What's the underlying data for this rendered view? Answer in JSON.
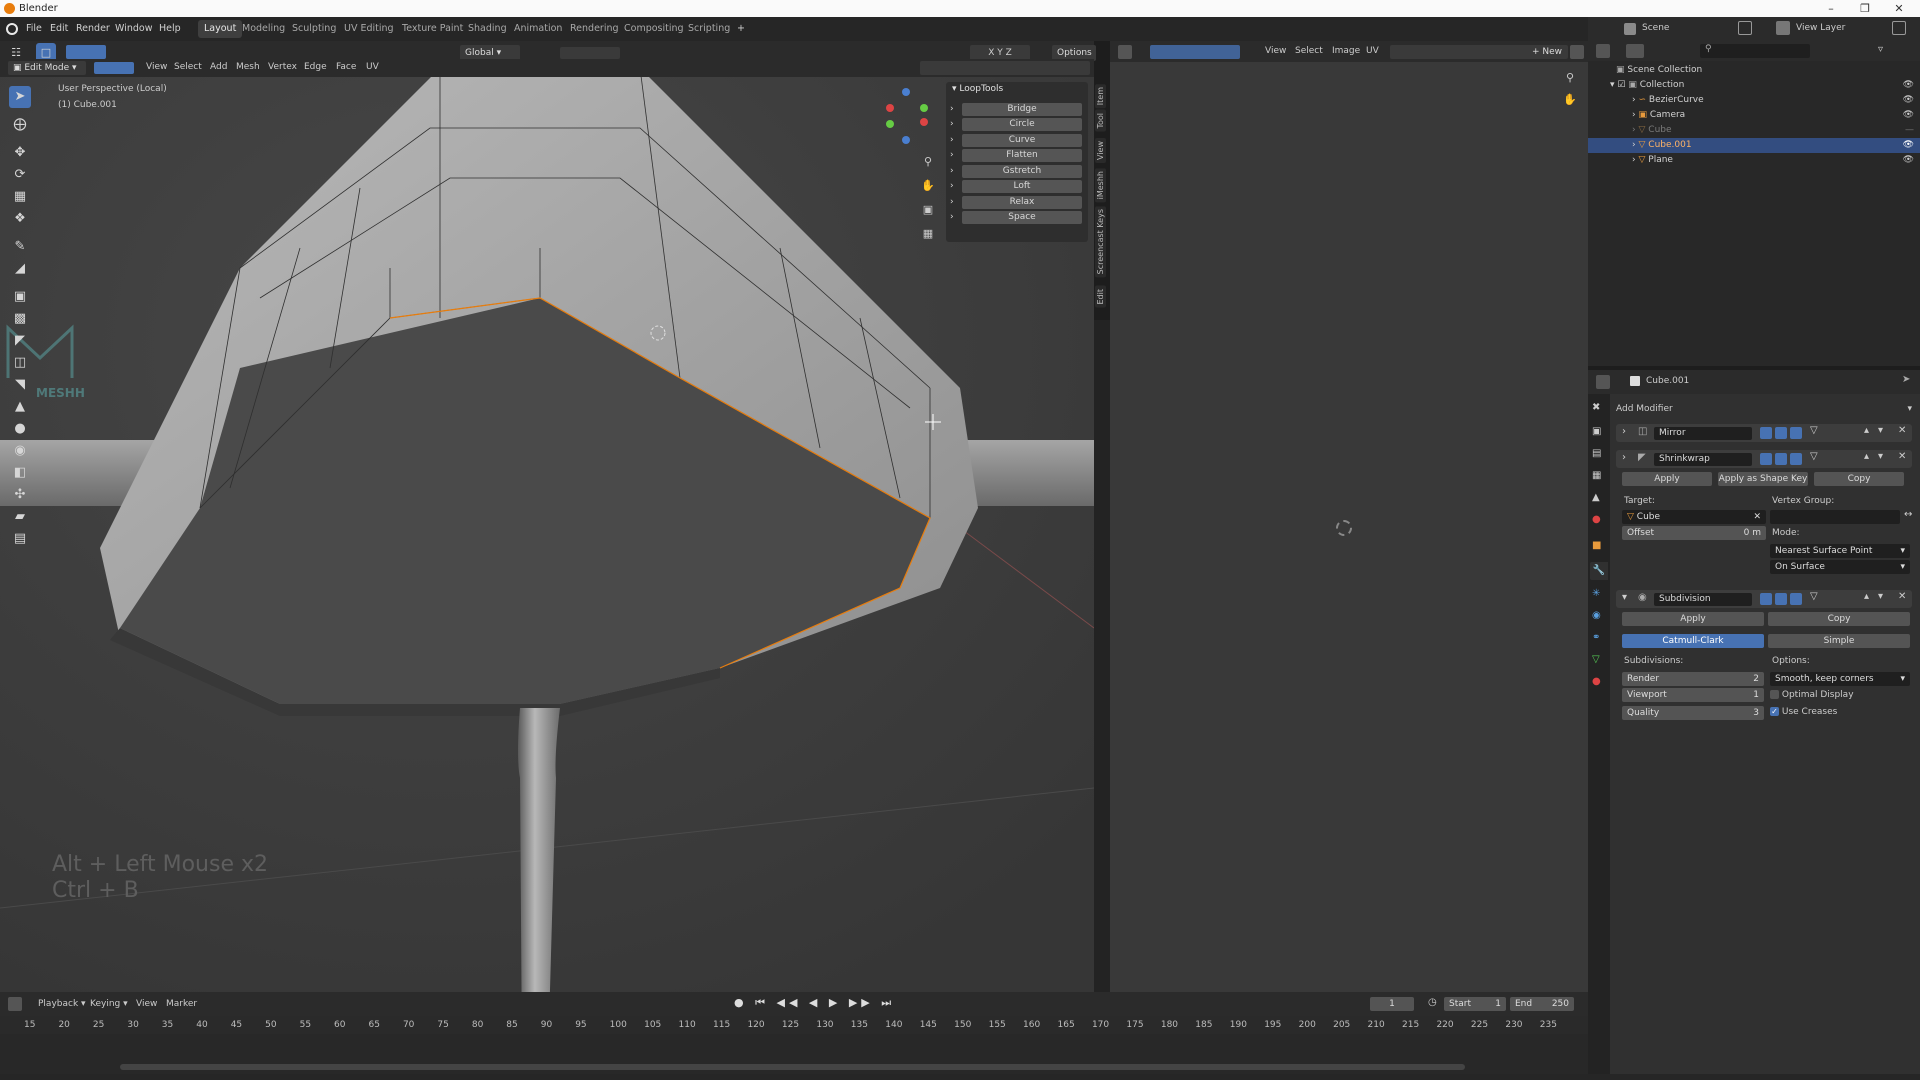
{
  "window": {
    "title": "Blender"
  },
  "menu": [
    "File",
    "Edit",
    "Render",
    "Window",
    "Help"
  ],
  "workspaces": [
    "Layout",
    "Modeling",
    "Sculpting",
    "UV Editing",
    "Texture Paint",
    "Shading",
    "Animation",
    "Rendering",
    "Compositing",
    "Scripting"
  ],
  "workspace_add": "+",
  "scene": {
    "label": "Scene",
    "view_layer": "View Layer"
  },
  "viewport": {
    "mode": "Edit Mode",
    "header_menus": [
      "View",
      "Select",
      "Add",
      "Mesh",
      "Vertex",
      "Edge",
      "Face",
      "UV"
    ],
    "orientation": "Global",
    "axes": "X Y Z",
    "options": "Options",
    "perspective": "User Perspective (Local)",
    "object": "(1) Cube.001",
    "overlay_line1": "Alt + Left Mouse x2",
    "overlay_line2": "Ctrl + B",
    "watermark": "MESHH"
  },
  "looptools": {
    "title": "LoopTools",
    "items": [
      "Bridge",
      "Circle",
      "Curve",
      "Flatten",
      "Gstretch",
      "Loft",
      "Relax",
      "Space"
    ]
  },
  "side_tabs": [
    "Item",
    "Tool",
    "View",
    "iMeshh",
    "Screencast Keys",
    "Edit"
  ],
  "image_editor": {
    "menus": [
      "View",
      "Select",
      "Image",
      "UV"
    ],
    "new": "New"
  },
  "outliner": {
    "items": [
      {
        "name": "Scene Collection",
        "level": 0
      },
      {
        "name": "Collection",
        "level": 1
      },
      {
        "name": "BezierCurve",
        "level": 2
      },
      {
        "name": "Camera",
        "level": 2
      },
      {
        "name": "Cube",
        "level": 2,
        "dim": true
      },
      {
        "name": "Cube.001",
        "level": 2,
        "selected": true
      },
      {
        "name": "Plane",
        "level": 2
      }
    ]
  },
  "properties": {
    "object": "Cube.001",
    "add_modifier": "Add Modifier",
    "mirror": {
      "name": "Mirror"
    },
    "shrinkwrap": {
      "name": "Shrinkwrap",
      "apply": "Apply",
      "apply_shape": "Apply as Shape Key",
      "copy": "Copy",
      "target_label": "Target:",
      "target": "Cube",
      "vgroup_label": "Vertex Group:",
      "offset_label": "Offset",
      "offset": "0 m",
      "mode_label": "Mode:",
      "mode": "Nearest Surface Point",
      "mode2": "On Surface"
    },
    "subdivision": {
      "name": "Subdivision",
      "apply": "Apply",
      "copy": "Copy",
      "type_a": "Catmull-Clark",
      "type_b": "Simple",
      "subdiv_label": "Subdivisions:",
      "options_label": "Options:",
      "render_label": "Render",
      "render": "2",
      "viewport_label": "Viewport",
      "viewport": "1",
      "quality_label": "Quality",
      "quality": "3",
      "uv_option": "Smooth, keep corners",
      "optimal": "Optimal Display",
      "creases": "Use Creases"
    }
  },
  "timeline": {
    "menus": [
      "Playback",
      "Keying",
      "View",
      "Marker"
    ],
    "current": "1",
    "start_label": "Start",
    "start": "1",
    "end_label": "End",
    "end": "250",
    "ticks": [
      "15",
      "20",
      "25",
      "30",
      "35",
      "40",
      "45",
      "50",
      "55",
      "60",
      "65",
      "70",
      "75",
      "80",
      "85",
      "90",
      "95",
      "100",
      "105",
      "110",
      "115",
      "120",
      "125",
      "130",
      "135",
      "140",
      "145",
      "150",
      "155",
      "160",
      "165",
      "170",
      "175",
      "180",
      "185",
      "190",
      "195",
      "200",
      "205",
      "210",
      "215",
      "220",
      "225",
      "230",
      "235"
    ]
  },
  "colors": {
    "accent": "#4772b3",
    "selection": "#e87d0d",
    "active_row": "#334d80"
  }
}
